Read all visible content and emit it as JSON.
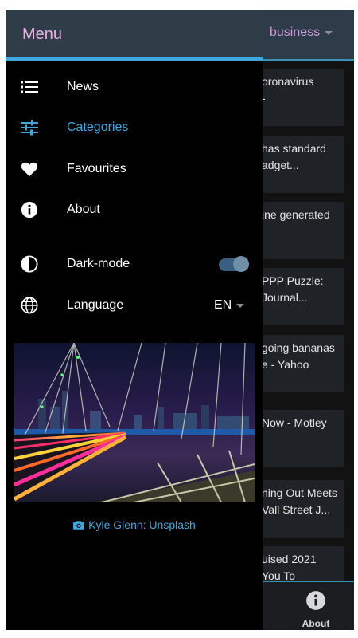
{
  "header": {
    "category_select": "business"
  },
  "cards": [
    {
      "text": "oronavirus\n-"
    },
    {
      "text": "has standard\nadget..."
    },
    {
      "text": "ine generated"
    },
    {
      "text": "PPP Puzzle:\nJournal..."
    },
    {
      "text": "going bananas\ne - Yahoo"
    },
    {
      "text": "Now - Motley"
    },
    {
      "text": "ning Out Meets\nVall Street J..."
    },
    {
      "text": "uised 2021\n You To"
    }
  ],
  "bottom_nav": {
    "about_label": "About"
  },
  "drawer": {
    "title": "Menu",
    "items": [
      {
        "label": "News",
        "icon": "list-icon"
      },
      {
        "label": "Categories",
        "icon": "sliders-icon",
        "active": true
      },
      {
        "label": "Favourites",
        "icon": "heart-icon"
      },
      {
        "label": "About",
        "icon": "info-icon"
      }
    ],
    "dark_mode": {
      "label": "Dark-mode",
      "icon": "contrast-icon",
      "enabled": true
    },
    "language": {
      "label": "Language",
      "icon": "globe-icon",
      "value": "EN"
    },
    "photo_credit": "Kyle Glenn: Unsplash"
  },
  "colors": {
    "accent": "#3fa7dc",
    "title": "#e8b0e6",
    "header_bg": "#2f3d49",
    "drawer_bg": "#000000",
    "card_bg": "#1f2226"
  }
}
